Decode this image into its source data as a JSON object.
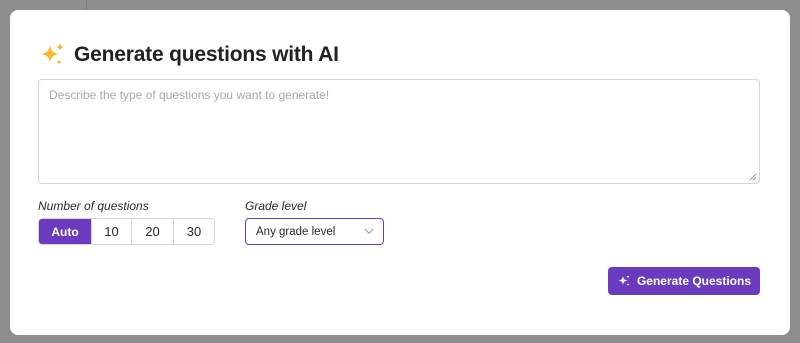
{
  "modal": {
    "title": "Generate questions with AI",
    "title_icon": "sparkles-icon",
    "prompt": {
      "value": "",
      "placeholder": "Describe the type of questions you want to generate!"
    },
    "question_count": {
      "label": "Number of questions",
      "options": [
        "Auto",
        "10",
        "20",
        "30"
      ],
      "selected": "Auto"
    },
    "grade_level": {
      "label": "Grade level",
      "selected": "Any grade level"
    },
    "generate_button": {
      "label": "Generate Questions",
      "icon": "magic-sparkle-icon"
    }
  },
  "colors": {
    "accent": "#6a3bbf",
    "overlay": "#8e8e8e",
    "modal_bg": "#ffffff",
    "border": "#d6d6d6",
    "sparkle_gold": "#f5b82e"
  }
}
